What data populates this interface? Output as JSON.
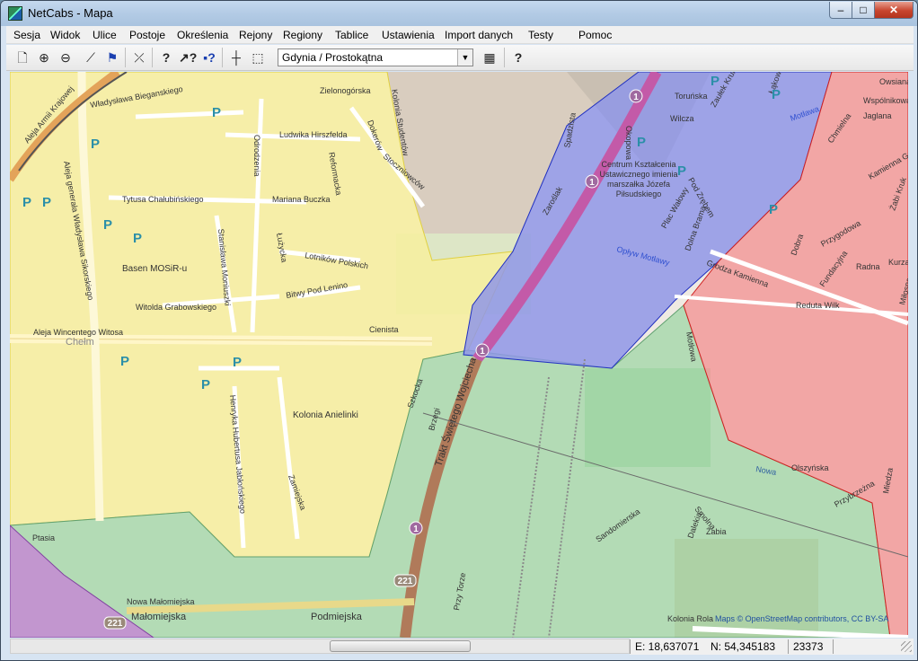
{
  "window": {
    "title": "NetCabs - Mapa",
    "minimize_glyph": "–",
    "maximize_glyph": "□",
    "close_glyph": "✕"
  },
  "menu": [
    {
      "label": "Sesja"
    },
    {
      "label": "Widok"
    },
    {
      "label": "Ulice"
    },
    {
      "label": "Postoje"
    },
    {
      "label": "Określenia"
    },
    {
      "label": "Rejony"
    },
    {
      "label": "Regiony"
    },
    {
      "label": "Tablice"
    },
    {
      "label": "Ustawienia"
    },
    {
      "label": "Import danych"
    },
    {
      "label": "Testy"
    },
    {
      "label": "Pomoc"
    }
  ],
  "toolbar": {
    "icons": [
      "new-document-icon",
      "zoom-in-icon",
      "zoom-out-icon",
      "draw-line-icon",
      "flag-icon",
      "split-icon",
      "query-icon",
      "query-point-icon",
      "query-text-icon",
      "crosshair-icon",
      "selection-rectangle-icon",
      "grid-icon",
      "help-icon"
    ],
    "region_select_value": "Gdynia / Prostokątna"
  },
  "map": {
    "street_labels": [
      "Aleja Armii Krajowej",
      "Władysława Bieganskiego",
      "Odrodzenia",
      "Ludwika Hirszfelda",
      "Zielonogórska",
      "Kolonia Studentów",
      "Dokerów",
      "Stoczniowców",
      "Reformacka",
      "Tytusa Chałubińskiego",
      "Mariana Buczka",
      "Aleja generała Władysława Sikorskiego",
      "Stanisława Moniuszki",
      "Łużycka",
      "Lotników Polskich",
      "Basen MOSiR-u",
      "Bitwy Pod Lenino",
      "Witolda Grabowskiego",
      "Aleja Wincentego Witosa",
      "Chełm",
      "Cienista",
      "Kolonia Anielinki",
      "Henryka Hubertusa Jabłońskiego",
      "Zamiejska",
      "Ptasia",
      "Nowa Małomiejska",
      "Małomiejska",
      "Podmiejska",
      "Szkocka",
      "Brzegi",
      "Trakt Świętego Wojciecha",
      "Przy Torze",
      "Zaroślak",
      "Spadzista",
      "Okopowa",
      "Toruńska",
      "Wilcza",
      "Zaułek Kruk",
      "Łąkowa",
      "Motława",
      "Centrum Kształcenia Ustawicznego imienia marszałka Józefa Piłsudskiego",
      "Plac Wałowy",
      "Pod Zrębem",
      "Dolna Brama",
      "Opływ Motławy",
      "Grodza Kamienna",
      "Reduta Wilk",
      "Owsiana",
      "Wspólnikowa",
      "Jaglana",
      "Chmielna",
      "Kamienna Grobla",
      "Żabi Kruk",
      "Dobra",
      "Przygodowa",
      "Radna",
      "Kurza",
      "Fundacyjna",
      "Miłosna",
      "Olszyńska",
      "Miedza",
      "Przybrzeżna",
      "Sandomierska",
      "Smolna",
      "Dalekia",
      "Żabia",
      "Kolonia Rola",
      "Motłowa",
      "Nowa"
    ],
    "route_shields": [
      "1",
      "221"
    ],
    "parking_glyph": "P",
    "attribution": "Maps © OpenStreetMap contributors, CC BY-SA"
  },
  "status": {
    "longitude": "E: 18,637071",
    "latitude": "N: 54,345183",
    "code": "23373"
  }
}
